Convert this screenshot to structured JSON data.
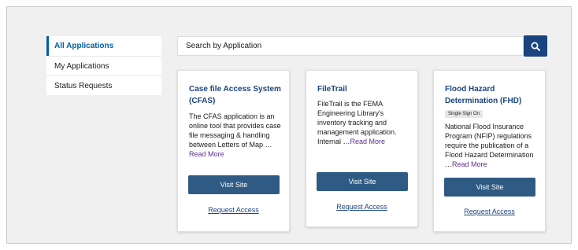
{
  "sidebar": {
    "items": [
      {
        "label": "All Applications"
      },
      {
        "label": "My Applications"
      },
      {
        "label": "Status Requests"
      }
    ]
  },
  "search": {
    "placeholder": "Search by Application"
  },
  "icons": {
    "search": "search-icon"
  },
  "colors": {
    "primary": "#1a4480",
    "button": "#2f5a84",
    "background": "#f0f0f0",
    "read_more": "#5c2d91"
  },
  "cards": [
    {
      "title": "Case file Access System (CFAS)",
      "badge": "",
      "description": "The CFAS application is an online tool that provides case file messaging & handling between Letters of Map …",
      "read_more": "Read More",
      "visit_label": "Visit Site",
      "request_label": "Request Access"
    },
    {
      "title": "FileTrail",
      "badge": "",
      "description": "FileTrail  is the FEMA Engineering Library's inventory tracking and management application. Internal …",
      "read_more": "Read More",
      "visit_label": "Visit Site",
      "request_label": "Request Access"
    },
    {
      "title": "Flood Hazard Determination (FHD)",
      "badge": "Single Sign On",
      "description": "National Flood Insurance Program (NFIP) regulations require the publication of a Flood Hazard Determination …",
      "read_more": "Read More",
      "visit_label": "Visit Site",
      "request_label": "Request Access"
    }
  ]
}
